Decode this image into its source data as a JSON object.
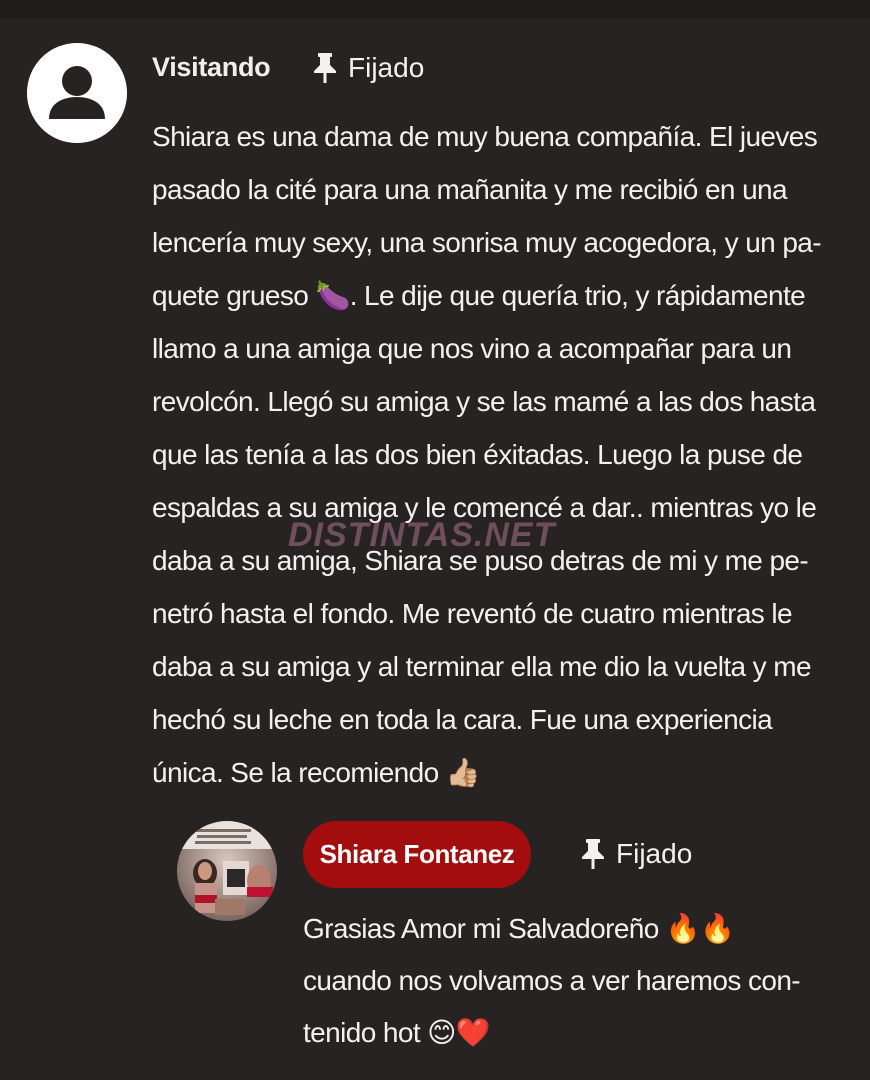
{
  "comment": {
    "author": "Visitando",
    "pinned_label": "Fijado",
    "avatar_icon": "person-icon",
    "lines": [
      "Shiara es una dama de muy buena compañía. El jueves",
      "pasado la cité para una mañanita y me recibió en una",
      "lencería muy sexy, una sonrisa muy acogedora, y un pa-",
      "quete grueso 🍆. Le dije que quería trio, y rápidamente",
      "llamo a una amiga que nos vino a acompañar para un",
      "revolcón. Llegó su amiga y se las mamé a las dos hasta",
      "que las tenía a las dos bien éxitadas. Luego la puse de",
      "espaldas a su amiga y le comencé a dar.. mientras yo le",
      "daba a su amiga, Shiara se puso detras de mi y me pe-",
      "netró hasta el fondo. Me reventó de cuatro mientras le",
      "daba a su amiga y al terminar ella me dio la vuelta y me",
      "hechó su leche en toda la cara. Fue una experiencia",
      "única. Se la recomiendo 👍🏼"
    ]
  },
  "watermark": "DISTINTAS.NET",
  "reply": {
    "author": "Shiara Fontanez",
    "pinned_label": "Fijado",
    "lines": [
      "Grasias Amor mi Salvadoreño 🔥🔥",
      "cuando nos volvamos a ver haremos con-",
      "tenido hot 😊❤️"
    ]
  },
  "colors": {
    "background": "#282323",
    "author_badge": "#a30d0d",
    "text": "#f4f1f1"
  },
  "icons": {
    "pin": "pin-icon",
    "avatar_default": "person-icon"
  }
}
